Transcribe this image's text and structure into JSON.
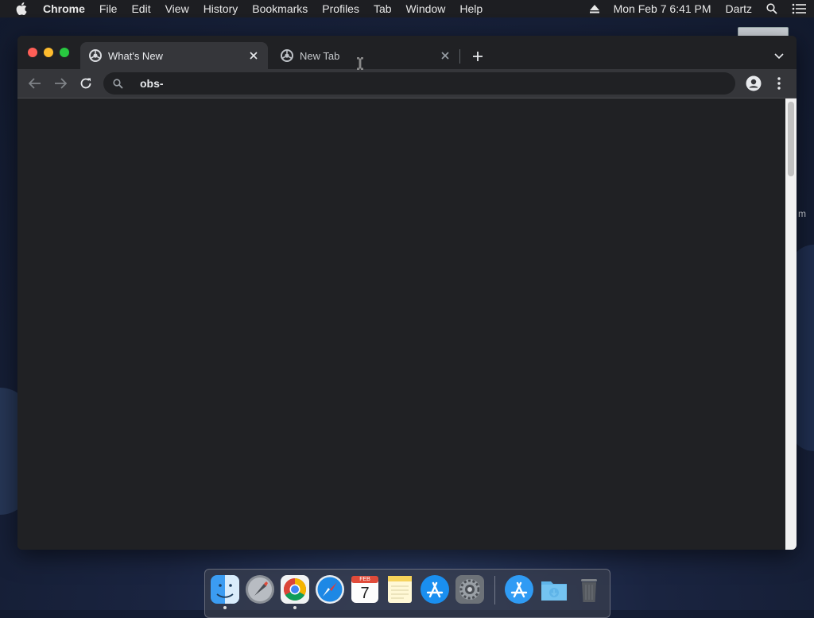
{
  "menubar": {
    "app_name": "Chrome",
    "items": [
      "File",
      "Edit",
      "View",
      "History",
      "Bookmarks",
      "Profiles",
      "Tab",
      "Window",
      "Help"
    ],
    "datetime": "Mon Feb 7  6:41 PM",
    "user": "Dartz"
  },
  "browser": {
    "tabs": [
      {
        "title": "What's New",
        "active": true
      },
      {
        "title": "New Tab",
        "active": false
      }
    ],
    "omnibox": {
      "value": "obs-"
    }
  },
  "desktop": {
    "partial_label": "m"
  },
  "dock": {
    "calendar_month": "FEB",
    "calendar_day": "7",
    "items": [
      "finder-icon",
      "launchpad-icon",
      "chrome-icon",
      "safari-icon",
      "calendar-icon",
      "notes-icon",
      "app-store-icon",
      "system-preferences-icon",
      "app-store-icon",
      "downloads-folder-icon",
      "trash-icon"
    ]
  },
  "colors": {
    "window_bg": "#202124",
    "toolbar_bg": "#35363a",
    "menubar_bg": "#1d1e22"
  }
}
